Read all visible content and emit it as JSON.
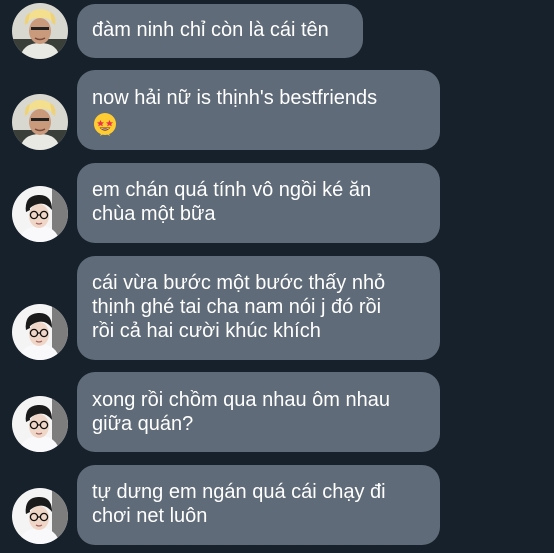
{
  "colors": {
    "background": "#17212b",
    "bubble": "#5f6b78",
    "text": "#ffffff"
  },
  "messages": [
    {
      "avatar": "blonde-man-avatar",
      "text": "đàm ninh chỉ còn là cái tên"
    },
    {
      "avatar": "blonde-man-avatar",
      "text": "now hải nữ is thịnh's bestfriends",
      "emoji": "star-struck-emoji"
    },
    {
      "avatar": "glasses-boy-avatar",
      "text": "em chán quá tính vô ngồi ké ăn\nchùa một bữa"
    },
    {
      "avatar": "glasses-boy-avatar",
      "text": "cái vừa bước một bước thấy nhỏ\nthịnh ghé tai cha nam nói j đó rồi\nrồi cả hai cười khúc khích"
    },
    {
      "avatar": "glasses-boy-avatar",
      "text": "xong rồi chồm qua nhau ôm nhau\ngiữa quán?"
    },
    {
      "avatar": "glasses-boy-avatar",
      "text": "tự dưng em ngán quá cái chạy đi\nchơi net luôn"
    }
  ]
}
